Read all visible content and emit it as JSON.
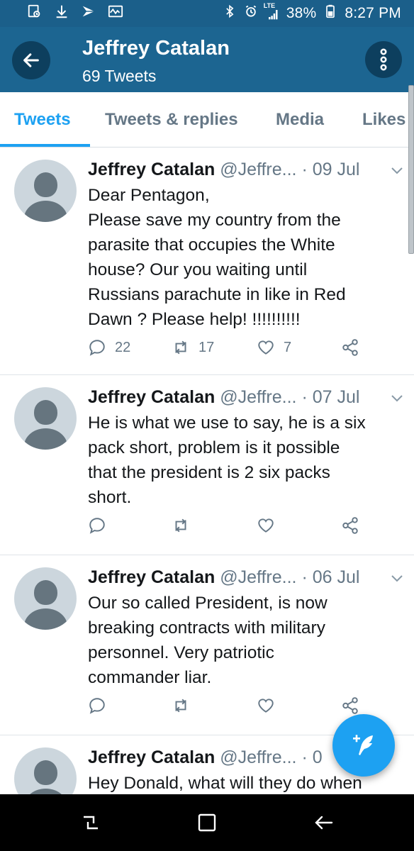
{
  "status_bar": {
    "left_icons": [
      "gallery-notification-icon",
      "download-icon",
      "sprint-icon",
      "activity-icon"
    ],
    "right_icons": [
      "bluetooth-icon",
      "alarm-icon",
      "lte-signal-icon",
      "battery-icon"
    ],
    "network_label": "LTE",
    "battery_percent": "38%",
    "time": "8:27 PM"
  },
  "header": {
    "title": "Jeffrey Catalan",
    "subtitle": "69 Tweets",
    "background": "#1c6591"
  },
  "tabs": {
    "active": "Tweets",
    "items": [
      {
        "label": "Tweets"
      },
      {
        "label": "Tweets & replies"
      },
      {
        "label": "Media"
      },
      {
        "label": "Likes"
      }
    ]
  },
  "tweets": [
    {
      "name": "Jeffrey Catalan",
      "handle": "@Jeffre...",
      "dot": "·",
      "date": "09 Jul",
      "lines": [
        "Dear Pentagon,",
        "Please save my country from the",
        "parasite that occupies the White",
        "house? Our you waiting until",
        "Russians parachute in like in Red",
        "Dawn ? Please help! !!!!!!!!!!"
      ],
      "replies": "22",
      "retweets": "17",
      "likes": "7"
    },
    {
      "name": "Jeffrey Catalan",
      "handle": "@Jeffre...",
      "dot": "·",
      "date": "07 Jul",
      "lines": [
        "He is what we use to say, he is a six",
        "pack short, problem is it possible",
        "that the president is 2 six packs",
        "short."
      ],
      "replies": "",
      "retweets": "",
      "likes": ""
    },
    {
      "name": "Jeffrey Catalan",
      "handle": "@Jeffre...",
      "dot": "·",
      "date": "06 Jul",
      "lines": [
        "Our so called President, is now",
        "breaking contracts with military",
        "personnel. Very patriotic",
        "commander liar."
      ],
      "replies": "",
      "retweets": "",
      "likes": ""
    },
    {
      "name": "Jeffrey Catalan",
      "handle": "@Jeffre...",
      "dot": "·",
      "date": "0",
      "lines": [
        "Hey Donald, what will they do when"
      ],
      "replies": "",
      "retweets": "",
      "likes": ""
    }
  ],
  "fab": {
    "icon": "compose-tweet-icon",
    "color": "#1da1f2"
  },
  "nav_bar": {
    "icons": [
      "recent-apps-icon",
      "home-icon",
      "back-icon"
    ]
  }
}
